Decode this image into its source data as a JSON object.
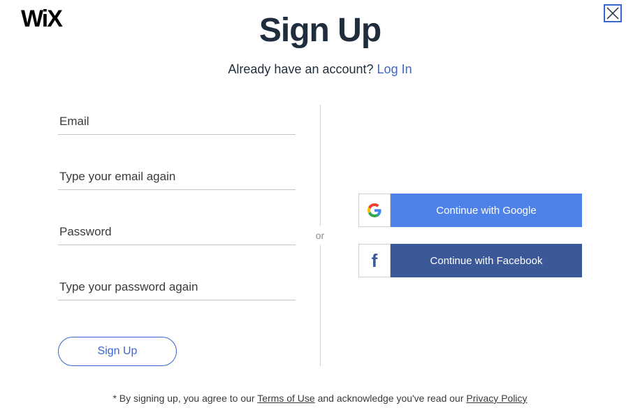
{
  "brand": "WiX",
  "title": "Sign Up",
  "subtitle_prefix": "Already have an account? ",
  "login_link": "Log In",
  "form": {
    "email_placeholder": "Email",
    "email_confirm_placeholder": "Type your email again",
    "password_placeholder": "Password",
    "password_confirm_placeholder": "Type your password again",
    "submit_label": "Sign Up"
  },
  "divider": "or",
  "social": {
    "google_label": "Continue with Google",
    "facebook_label": "Continue with Facebook"
  },
  "footer": {
    "prefix": "* By signing up, you agree to our ",
    "terms": "Terms of Use",
    "middle": " and acknowledge you've read our ",
    "privacy": "Privacy Policy"
  }
}
